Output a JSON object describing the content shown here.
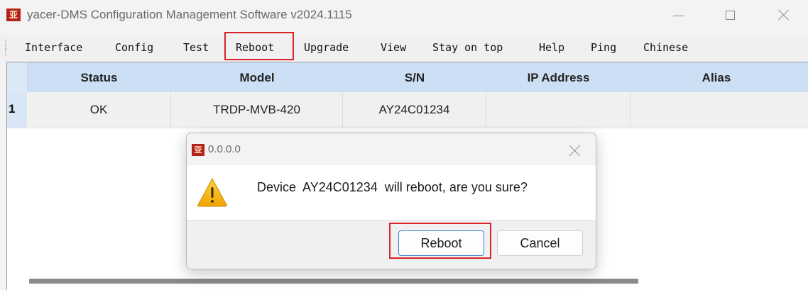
{
  "window": {
    "app_icon_glyph": "亚",
    "title": "yacer-DMS Configuration Management Software v2024.1115",
    "controls": [
      "minimize-icon",
      "maximize-icon",
      "close-icon"
    ]
  },
  "menu": {
    "items": [
      "Interface",
      "Config",
      "Test",
      "Reboot",
      "Upgrade",
      "View",
      "Stay on top",
      "Help",
      "Ping",
      "Chinese"
    ],
    "highlighted_item": "Reboot"
  },
  "grid": {
    "columns": [
      "Status",
      "Model",
      "S/N",
      "IP Address",
      "Alias"
    ],
    "rows": [
      {
        "index": "1",
        "status": "OK",
        "model": "TRDP-MVB-420",
        "sn": "AY24C01234",
        "ip": "",
        "alias": ""
      }
    ]
  },
  "dialog": {
    "icon_glyph": "亚",
    "title": "0.0.0.0",
    "icon": "warning-icon",
    "message": "Device  AY24C01234  will reboot, are you sure?",
    "confirm_label": "Reboot",
    "cancel_label": "Cancel",
    "highlighted_button": "Reboot"
  },
  "colors": {
    "highlight": "#d8232a",
    "header_bg": "#ccdff4",
    "app_icon": "#b5221b",
    "warning": "#f5b400"
  }
}
